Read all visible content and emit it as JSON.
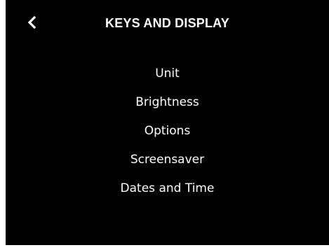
{
  "header": {
    "title": "KEYS AND DISPLAY",
    "back_icon": "chevron-left-icon"
  },
  "menu": {
    "items": [
      {
        "label": "Unit"
      },
      {
        "label": "Brightness"
      },
      {
        "label": "Options"
      },
      {
        "label": "Screensaver"
      },
      {
        "label": "Dates and Time"
      }
    ]
  },
  "colors": {
    "background": "#000000",
    "text": "#ffffff"
  }
}
